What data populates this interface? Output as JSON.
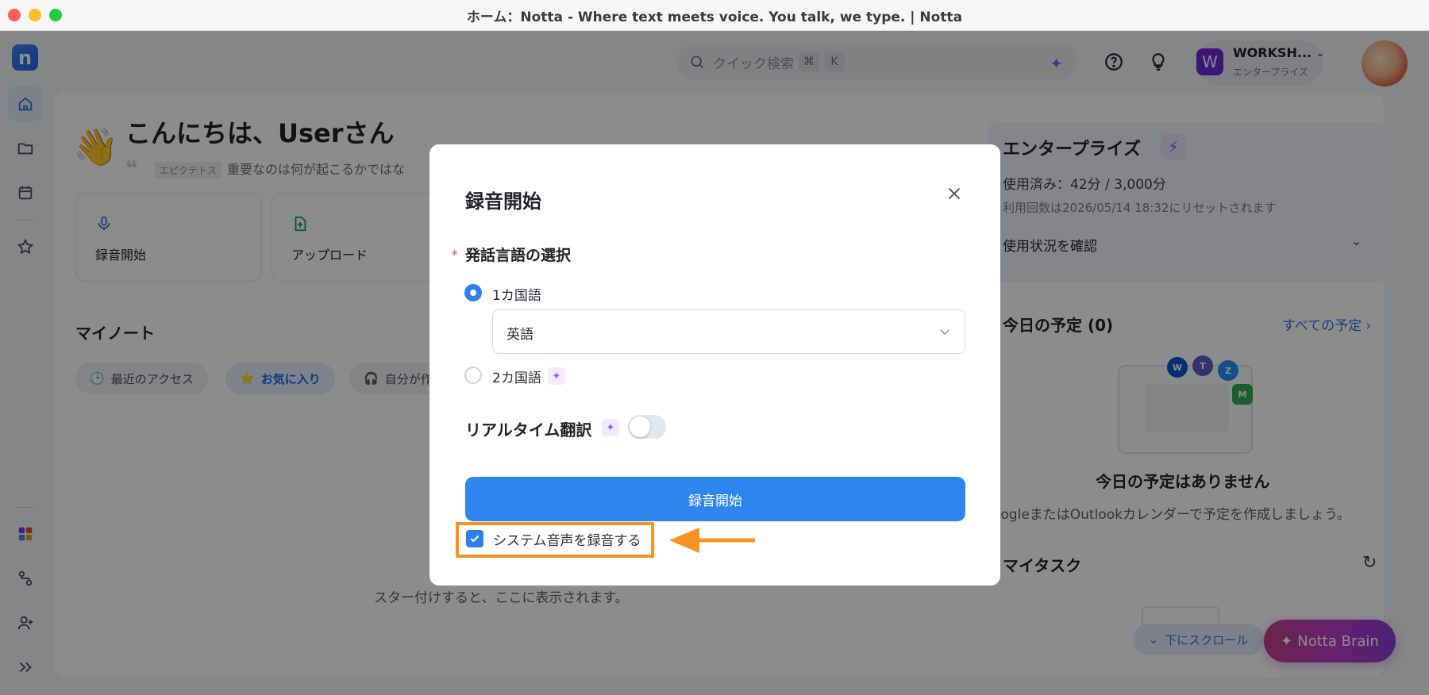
{
  "window": {
    "title": "ホーム：Notta - Where text meets voice. You talk, we type. | Notta"
  },
  "sidebar": {
    "logo": "n",
    "items": [
      "home-icon",
      "folder-icon",
      "calendar-icon",
      "star-icon",
      "apps-icon",
      "workflow-icon",
      "add-user-icon",
      "expand-icon"
    ]
  },
  "header": {
    "search_placeholder": "クイック検索",
    "shortcut_keys": [
      "⌘",
      "K"
    ],
    "workspace": {
      "badge": "W",
      "name": "WORKSH...",
      "plan": "エンタープライズ"
    }
  },
  "home": {
    "greeting": "こんにちは、Userさん",
    "quote_source": "エピクテトス",
    "quote_text": "重要なのは何が起こるかではな",
    "quick_actions": [
      {
        "label": "録音開始",
        "icon": "mic-icon"
      },
      {
        "label": "アップロード",
        "icon": "upload-icon"
      }
    ],
    "notes_title": "マイノート",
    "filters": [
      {
        "label": "最近のアクセス",
        "icon": "clock-icon"
      },
      {
        "label": "お気に入り",
        "icon": "star-icon"
      },
      {
        "label": "自分が作",
        "icon": "headphones-icon"
      }
    ],
    "empty_hint": "スター付けすると、ここに表示されます。"
  },
  "plan": {
    "title": "エンタープライズ",
    "usage": "使用済み：42分 / 3,000分",
    "reset": "利用回数は2026/05/14 18:32にリセットされます",
    "check_usage": "使用状況を確認"
  },
  "today": {
    "title": "今日の予定 (0)",
    "all_link": "すべての予定",
    "empty_title": "今日の予定はありません",
    "empty_hint": "oogleまたはOutlookカレンダーで予定を作成しましょう。"
  },
  "tasks": {
    "title": "マイタスク"
  },
  "floating": {
    "scroll": "下にスクロール",
    "brain": "Notta Brain"
  },
  "modal": {
    "title": "録音開始",
    "language_label": "発話言語の選択",
    "required_mark": "*",
    "options": [
      {
        "label": "1カ国語",
        "selected": true
      },
      {
        "label": "2カ国語",
        "selected": false
      }
    ],
    "language_value": "英語",
    "realtime_label": "リアルタイム翻訳",
    "realtime_enabled": false,
    "start_button": "録音開始",
    "system_audio_label": "システム音声を録音する",
    "system_audio_checked": true
  },
  "colors": {
    "primary": "#2f85ee",
    "highlight": "#f7931e",
    "ai_purple": "#8b5cf6"
  }
}
